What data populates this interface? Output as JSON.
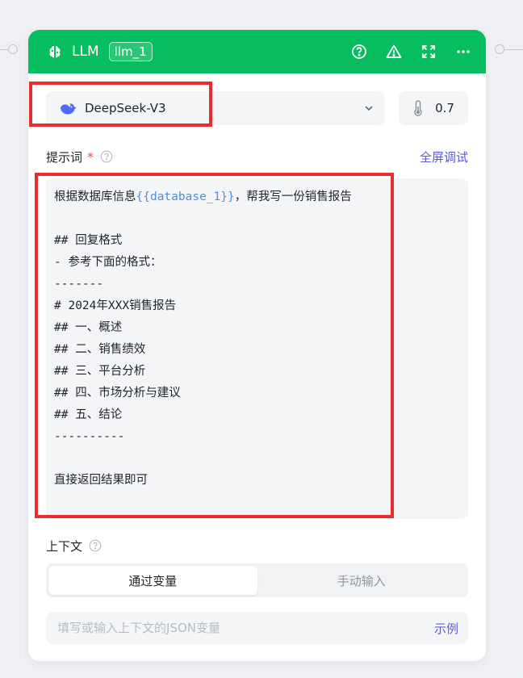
{
  "node": {
    "title": "LLM",
    "tag": "llm_1"
  },
  "model": {
    "name": "DeepSeek-V3",
    "temperature": "0.7"
  },
  "prompt": {
    "label": "提示词",
    "required_mark": "*",
    "fullscreen_link": "全屏调试",
    "lines": [
      {
        "pre": "根据数据库信息",
        "var": "{{database_1}}",
        "post": "，帮我写一份销售报告"
      },
      {
        "pre": "",
        "var": "",
        "post": ""
      },
      {
        "pre": "## 回复格式",
        "var": "",
        "post": ""
      },
      {
        "pre": "- 参考下面的格式：",
        "var": "",
        "post": ""
      },
      {
        "pre": "-------",
        "var": "",
        "post": ""
      },
      {
        "pre": "# 2024年XXX销售报告",
        "var": "",
        "post": ""
      },
      {
        "pre": "## 一、概述",
        "var": "",
        "post": ""
      },
      {
        "pre": "## 二、销售绩效",
        "var": "",
        "post": ""
      },
      {
        "pre": "## 三、平台分析",
        "var": "",
        "post": ""
      },
      {
        "pre": "## 四、市场分析与建议",
        "var": "",
        "post": ""
      },
      {
        "pre": "## 五、结论",
        "var": "",
        "post": ""
      },
      {
        "pre": "----------",
        "var": "",
        "post": ""
      },
      {
        "pre": "",
        "var": "",
        "post": ""
      },
      {
        "pre": "直接返回结果即可",
        "var": "",
        "post": ""
      }
    ]
  },
  "context": {
    "label": "上下文",
    "tabs": [
      "通过变量",
      "手动输入"
    ],
    "active_tab": 0,
    "input_placeholder": "填写或输入上下文的JSON变量",
    "example_link": "示例"
  },
  "colors": {
    "header": "#06bd60",
    "accent": "#5b57e8",
    "variable": "#4a90e2",
    "highlight_box": "#ea2c2c"
  }
}
